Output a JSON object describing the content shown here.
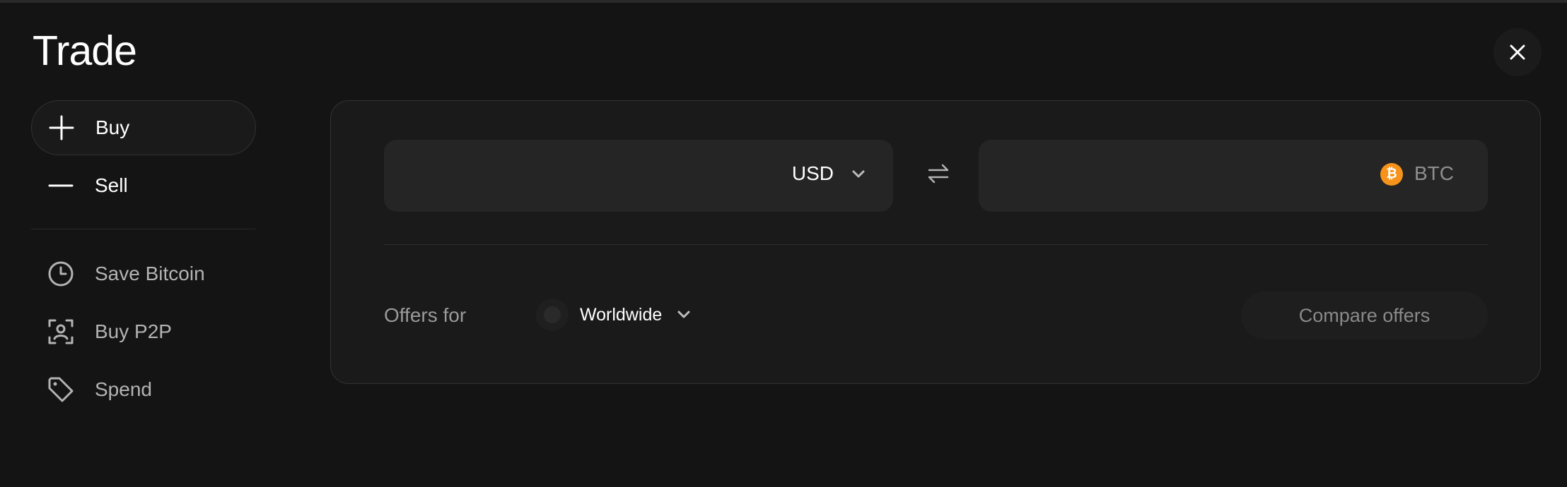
{
  "page": {
    "title": "Trade"
  },
  "header": {
    "close_icon": "close-icon"
  },
  "sidebar": {
    "items": [
      {
        "label": "Buy",
        "icon": "plus-icon",
        "active": true
      },
      {
        "label": "Sell",
        "icon": "minus-icon",
        "active": false
      },
      {
        "label": "Save Bitcoin",
        "icon": "clock-icon",
        "active": false
      },
      {
        "label": "Buy P2P",
        "icon": "person-scan-icon",
        "active": false
      },
      {
        "label": "Spend",
        "icon": "tag-icon",
        "active": false
      }
    ]
  },
  "trade": {
    "fiat_field": {
      "value": "",
      "currency": "USD"
    },
    "crypto_field": {
      "value": "",
      "currency": "BTC",
      "coin_symbol": "₿"
    },
    "offers_label": "Offers for",
    "region": "Worldwide",
    "compare_label": "Compare offers"
  },
  "colors": {
    "background": "#141414",
    "panel": "#1a1a1a",
    "field": "#252525",
    "bitcoin": "#f7931a",
    "text": "#ffffff",
    "muted": "#b3b3b3"
  }
}
